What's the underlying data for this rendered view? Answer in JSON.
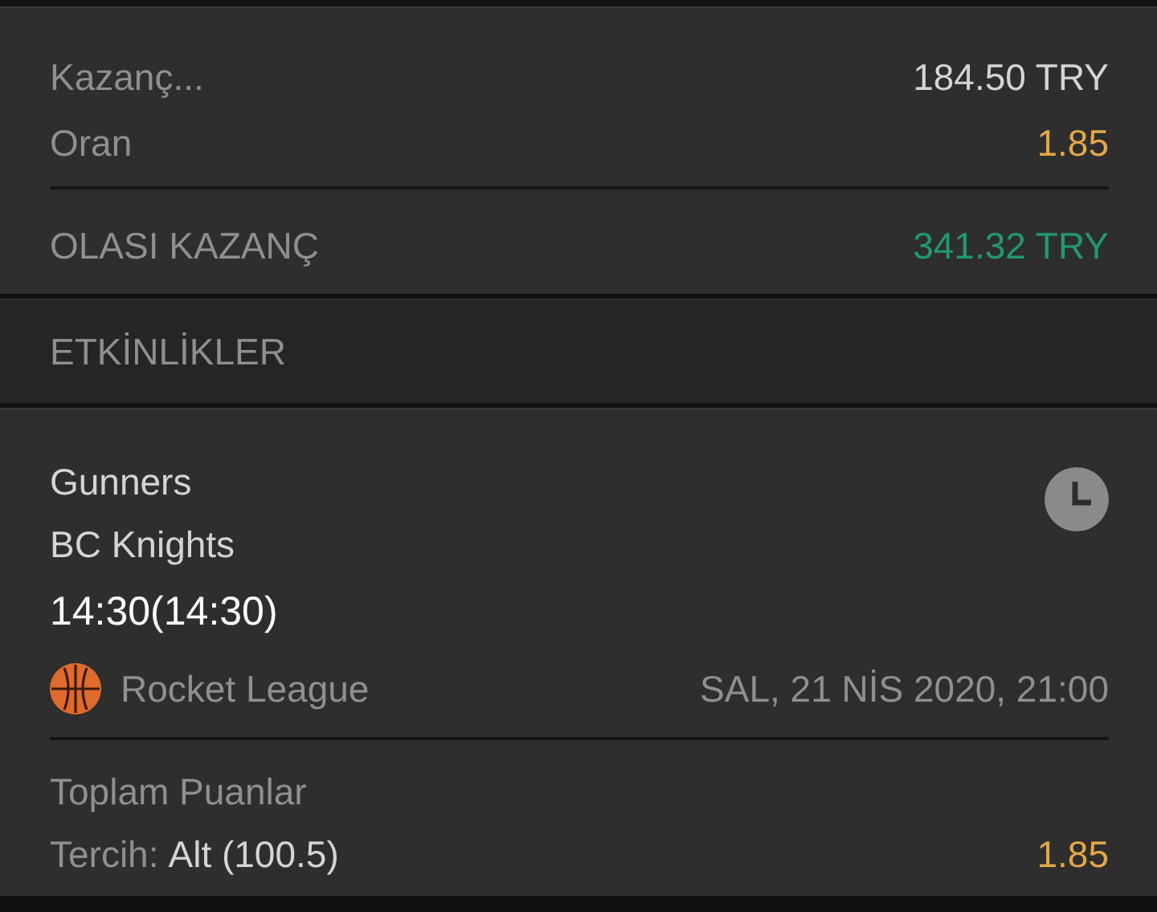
{
  "summary": {
    "rows": [
      {
        "label": "Kazanç...",
        "value": "184.50 TRY",
        "kind": "stake"
      },
      {
        "label": "Oran",
        "value": "1.85",
        "kind": "odds"
      }
    ],
    "total": {
      "label": "OLASI KAZANÇ",
      "value": "341.32 TRY"
    }
  },
  "section": {
    "title": "ETKİNLİKLER"
  },
  "event": {
    "home": "Gunners",
    "away": "BC Knights",
    "time": "14:30(14:30)",
    "league": "Rocket League",
    "date": "SAL, 21 NİS 2020, 21:00",
    "market": "Toplam Puanlar",
    "choice_label": "Tercih:",
    "choice": "Alt (100.5)",
    "odds": "1.85"
  }
}
